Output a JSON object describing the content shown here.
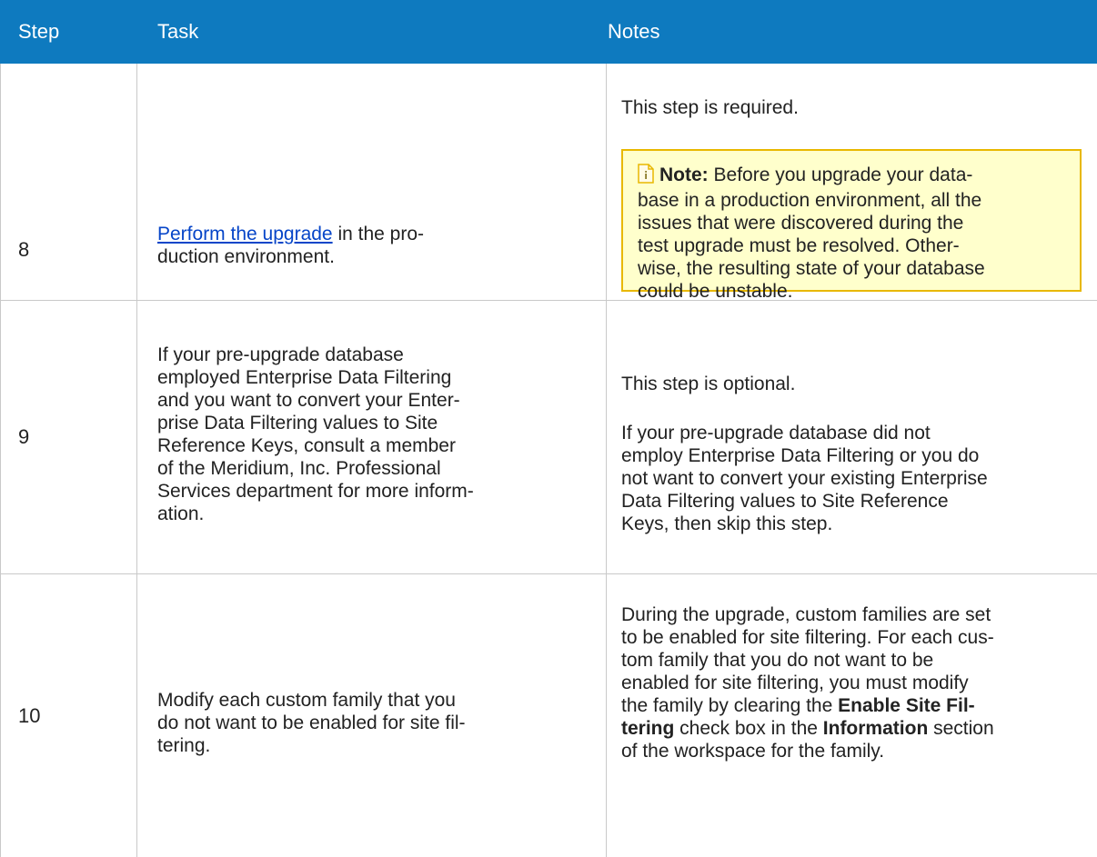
{
  "table": {
    "headers": {
      "step": "Step",
      "task": "Task",
      "notes": "Notes"
    },
    "rows": [
      {
        "step": "8",
        "task_link": "Perform the upgrade",
        "task_lines": [
          " in the pro-",
          "duction environment."
        ],
        "notes_lines": [
          "This step is required."
        ],
        "note": {
          "label": "Note:",
          "lines": [
            " Before you upgrade your data-",
            "base in a production environment, all the",
            "issues that were discovered during the",
            "test upgrade must be resolved. Other-",
            "wise, the resulting state of your database",
            "could be unstable."
          ]
        }
      },
      {
        "step": "9",
        "task_lines": [
          "If your pre-upgrade database",
          "employed Enterprise Data Filtering",
          "and you want to convert your Enter-",
          "prise Data Filtering values to Site",
          "Reference Keys, consult a member",
          "of the Meridium, Inc. Professional",
          "Services department for more inform-",
          "ation."
        ],
        "notes_p1": "This step is optional.",
        "notes_p2_lines": [
          "If your pre-upgrade database did not",
          "employ Enterprise Data Filtering or you do",
          "not want to convert your existing Enterprise",
          "Data Filtering values to Site Reference",
          "Keys, then skip this step."
        ]
      },
      {
        "step": "10",
        "task_lines": [
          "Modify each custom family that you",
          "do not want to be enabled for site fil-",
          "tering."
        ],
        "notes_lines": [
          "During the upgrade, custom families are set",
          "to be enabled for site filtering. For each cus-",
          "tom family that you do not want to be",
          "enabled for site filtering, you must modify",
          "the family by clearing the "
        ],
        "notes_bold_1a": "Enable Site Fil-",
        "notes_bold_1b": "tering",
        "notes_mid": " check box in the ",
        "notes_bold_2": "Information",
        "notes_after": " section",
        "notes_last": "of the workspace for the family."
      }
    ]
  },
  "colors": {
    "header_bg": "#0E7ABF",
    "note_bg": "#FFFFCC",
    "note_border": "#E8B800",
    "link": "#0645c8"
  },
  "icons": {
    "note": "note-document-icon"
  }
}
